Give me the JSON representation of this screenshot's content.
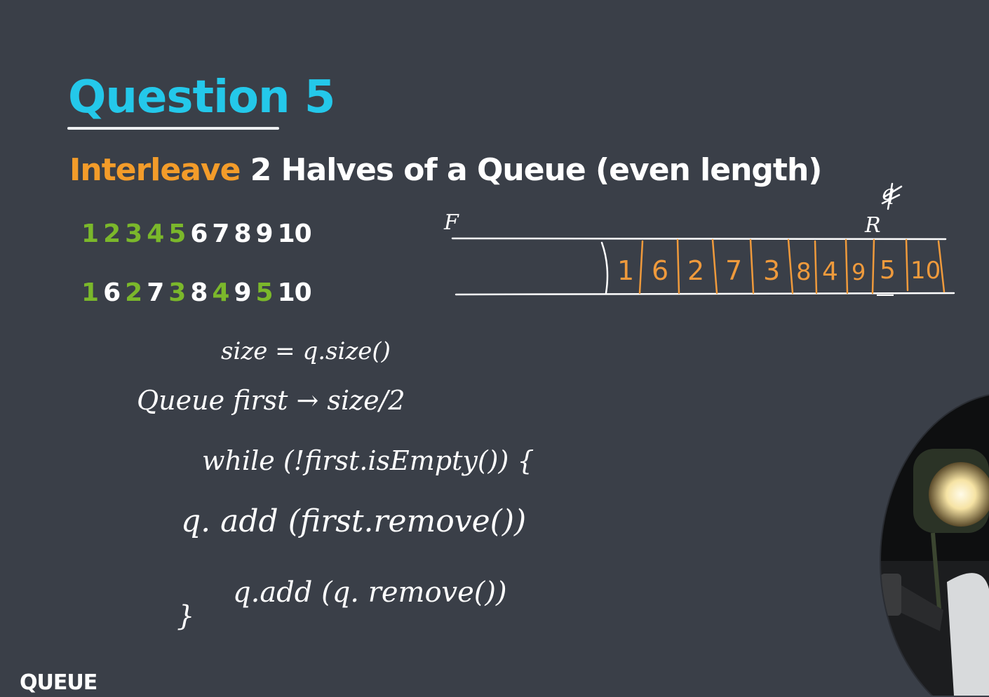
{
  "slide": {
    "title": "Question 5",
    "subtitle": {
      "accent": "Interleave",
      "rest": " 2 Halves of a Queue (even length)"
    },
    "sequence_original": [
      "1",
      "2",
      "3",
      "4",
      "5",
      "6",
      "7",
      "8",
      "9",
      "10"
    ],
    "sequence_interleaved": [
      "1",
      "6",
      "2",
      "7",
      "3",
      "8",
      "4",
      "9",
      "5",
      "10"
    ],
    "footer": "QUEUE"
  },
  "whiteboard": {
    "front_label": "F",
    "rear_label": "R",
    "rear_crossed_label": "q",
    "queue_cells": [
      "1",
      "6",
      "2",
      "7",
      "3",
      "8",
      "4",
      "9",
      "5",
      "10"
    ],
    "code_lines": [
      "size = q.size()",
      "Queue first → size/2",
      "while (!first.isEmpty()) {",
      "q. add (first.remove())",
      "q.add (q. remove())",
      "}"
    ]
  },
  "colors": {
    "background": "#3a3f48",
    "title": "#24c8ea",
    "accent_orange": "#f39c2a",
    "first_half_green": "#7bb82b",
    "queue_cell_orange": "#ef9a3c"
  }
}
